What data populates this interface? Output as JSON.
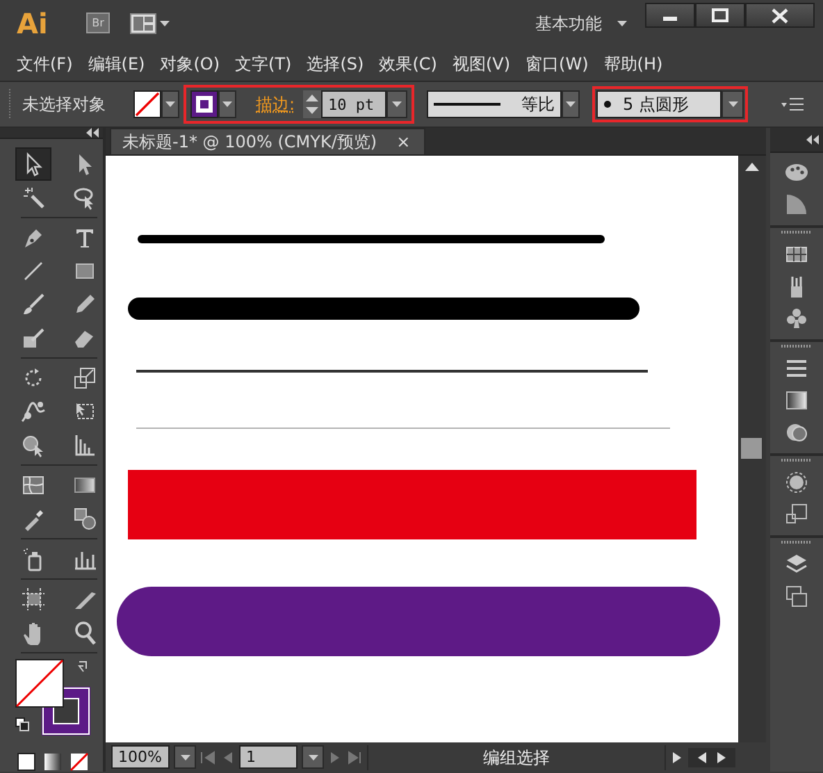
{
  "window": {
    "app_logo": "Ai",
    "bridge_button": "Br",
    "workspace": "基本功能"
  },
  "menu": [
    "文件(F)",
    "编辑(E)",
    "对象(O)",
    "文字(T)",
    "选择(S)",
    "效果(C)",
    "视图(V)",
    "窗口(W)",
    "帮助(H)"
  ],
  "control_bar": {
    "selection": "未选择对象",
    "stroke_swatch": {
      "color": "#5c1a87"
    },
    "stroke_label": "描边:",
    "stroke_weight": "10 pt",
    "profile": "等比",
    "brush": "5 点圆形",
    "stroke_highlighted": true,
    "brush_highlighted": true
  },
  "document_tab": {
    "title": "未标题-1* @ 100% (CMYK/预览)",
    "close": "×"
  },
  "artwork": [
    {
      "kind": "line",
      "color": "#000000"
    },
    {
      "kind": "line",
      "color": "#000000"
    },
    {
      "kind": "line",
      "color": "#333333"
    },
    {
      "kind": "line",
      "color": "#b4b4b4"
    },
    {
      "kind": "rect",
      "color": "#e60012"
    },
    {
      "kind": "pill",
      "color": "#5e1a86"
    }
  ],
  "tools": [
    {
      "selected": true
    },
    {
      "selected": false
    },
    {
      "selected": false
    },
    {
      "selected": false
    },
    {
      "selected": false
    },
    {
      "selected": false
    },
    {
      "selected": false
    },
    {
      "selected": false
    },
    {
      "selected": false
    },
    {
      "selected": false
    },
    {
      "selected": false
    },
    {
      "selected": false
    },
    {
      "selected": false
    },
    {
      "selected": false
    },
    {
      "selected": false
    },
    {
      "selected": false
    },
    {
      "selected": false
    },
    {
      "selected": false
    },
    {
      "selected": false
    },
    {
      "selected": false
    },
    {
      "selected": false
    },
    {
      "selected": false
    },
    {
      "selected": false
    },
    {
      "selected": false
    },
    {
      "selected": false
    },
    {
      "selected": false
    },
    {
      "selected": false
    },
    {
      "selected": false
    }
  ],
  "color_box": {
    "stroke_box": {
      "color": "#5c1a87"
    }
  },
  "status_bar": {
    "zoom": "100%",
    "page": "1",
    "status": "编组选择"
  }
}
